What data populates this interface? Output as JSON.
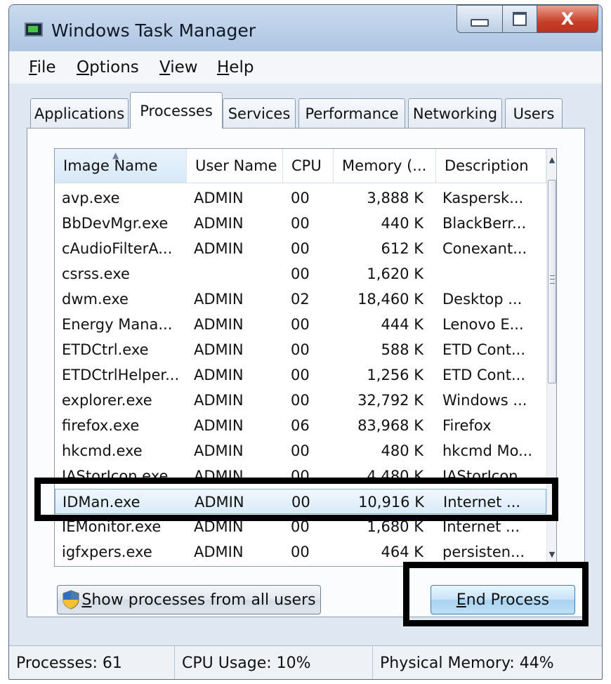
{
  "window": {
    "title": "Windows Task Manager",
    "close_glyph": "X"
  },
  "menu": [
    {
      "accel": "F",
      "rest": "ile"
    },
    {
      "accel": "O",
      "rest": "ptions"
    },
    {
      "accel": "V",
      "rest": "iew"
    },
    {
      "accel": "H",
      "rest": "elp"
    }
  ],
  "tabs": [
    "Applications",
    "Processes",
    "Services",
    "Performance",
    "Networking",
    "Users"
  ],
  "active_tab": "Processes",
  "table": {
    "columns": [
      "Image Name",
      "User Name",
      "CPU",
      "Memory (...",
      "Description"
    ],
    "rows": [
      {
        "name": "avp.exe",
        "user": "ADMIN",
        "cpu": "00",
        "mem": "3,888 K",
        "desc": "Kaspersk..."
      },
      {
        "name": "BbDevMgr.exe",
        "user": "ADMIN",
        "cpu": "00",
        "mem": "440 K",
        "desc": "BlackBerr..."
      },
      {
        "name": "cAudioFilterA...",
        "user": "ADMIN",
        "cpu": "00",
        "mem": "612 K",
        "desc": "Conexant..."
      },
      {
        "name": "csrss.exe",
        "user": "",
        "cpu": "00",
        "mem": "1,620 K",
        "desc": ""
      },
      {
        "name": "dwm.exe",
        "user": "ADMIN",
        "cpu": "02",
        "mem": "18,460 K",
        "desc": "Desktop ..."
      },
      {
        "name": "Energy Mana...",
        "user": "ADMIN",
        "cpu": "00",
        "mem": "444 K",
        "desc": "Lenovo E..."
      },
      {
        "name": "ETDCtrl.exe",
        "user": "ADMIN",
        "cpu": "00",
        "mem": "588 K",
        "desc": "ETD Cont..."
      },
      {
        "name": "ETDCtrlHelper...",
        "user": "ADMIN",
        "cpu": "00",
        "mem": "1,256 K",
        "desc": "ETD Cont..."
      },
      {
        "name": "explorer.exe",
        "user": "ADMIN",
        "cpu": "00",
        "mem": "32,792 K",
        "desc": "Windows ..."
      },
      {
        "name": "firefox.exe",
        "user": "ADMIN",
        "cpu": "06",
        "mem": "83,968 K",
        "desc": "Firefox"
      },
      {
        "name": "hkcmd.exe",
        "user": "ADMIN",
        "cpu": "00",
        "mem": "480 K",
        "desc": "hkcmd Mo..."
      },
      {
        "name": "IAStorIcon.exe",
        "user": "ADMIN",
        "cpu": "00",
        "mem": "4,480 K",
        "desc": "IAStorIcon..."
      },
      {
        "name": "IDMan.exe",
        "user": "ADMIN",
        "cpu": "00",
        "mem": "10,916 K",
        "desc": "Internet ..."
      },
      {
        "name": "IEMonitor.exe",
        "user": "ADMIN",
        "cpu": "00",
        "mem": "1,680 K",
        "desc": "Internet ..."
      },
      {
        "name": "igfxpers.exe",
        "user": "ADMIN",
        "cpu": "00",
        "mem": "464 K",
        "desc": "persisten..."
      }
    ],
    "selected_row": "IDMan.exe"
  },
  "buttons": {
    "show_all": {
      "accel": "S",
      "rest": "how processes from all users"
    },
    "end_process": {
      "accel": "E",
      "rest": "nd Process"
    }
  },
  "status": {
    "processes": "Processes: 61",
    "cpu": "CPU Usage: 10%",
    "memory": "Physical Memory: 44%"
  },
  "icons": [
    "task-manager-icon",
    "minimize-icon",
    "maximize-icon",
    "close-icon",
    "sort-ascending-icon",
    "uac-shield-icon",
    "scroll-up-icon",
    "scroll-down-icon"
  ],
  "colors": {
    "selection": "#d9ebfa",
    "annotation": "#000000",
    "close_button": "#c8402a"
  }
}
